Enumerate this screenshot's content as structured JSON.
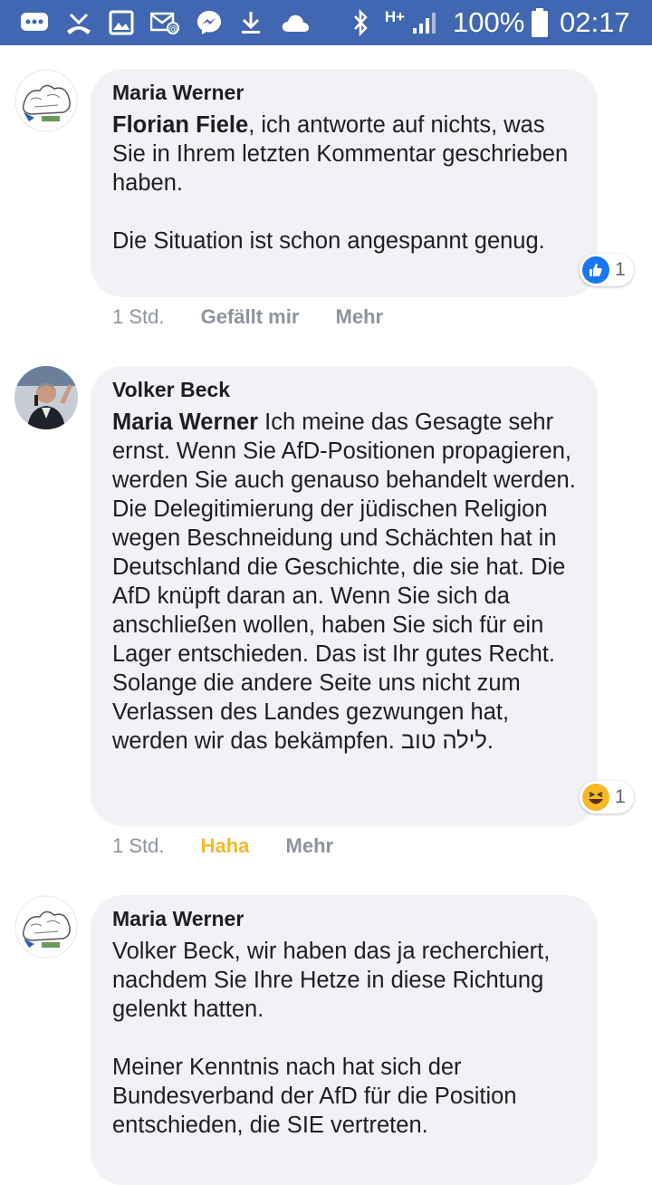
{
  "status_bar": {
    "battery": "100%",
    "time": "02:17",
    "network": "H+"
  },
  "comments": [
    {
      "author": "Maria Werner",
      "mention": "Florian Fiele",
      "text_1": ", ich antworte auf nichts, was Sie in Ihrem letzten Kommentar geschrieben haben.",
      "text_2": "Die Situation ist schon angespannt genug.",
      "time": "1 Std.",
      "like_label": "Gefällt mir",
      "more_label": "Mehr",
      "reaction_count": "1",
      "reaction_type": "like-icon"
    },
    {
      "author": "Volker Beck",
      "mention": "Maria Werner",
      "text_1": " Ich meine das Gesagte sehr ernst. Wenn Sie AfD-Positionen propagieren, werden Sie auch genauso behandelt werden. Die Delegitimierung der jüdischen Religion wegen Beschneidung und Schächten hat in Deutschland die Geschichte, die sie hat. Die AfD knüpft daran an. Wenn Sie sich da anschließen wollen, haben Sie sich für ein Lager entschieden. Das ist Ihr gutes Recht. Solange die andere Seite uns nicht zum Verlassen des Landes gezwungen hat, werden wir das bekämpfen. לילה טוב.",
      "time": "1 Std.",
      "like_label": "Haha",
      "more_label": "Mehr",
      "reaction_count": "1",
      "reaction_type": "haha-icon"
    },
    {
      "author": "Maria Werner",
      "text_1": "Volker Beck, wir haben das ja recherchiert, nachdem Sie Ihre Hetze in diese Richtung gelenkt hatten.",
      "text_2": "Meiner Kenntnis nach hat sich der Bundesverband der AfD für die Position entschieden, die SIE vertreten."
    }
  ],
  "colors": {
    "status_bar": "#4267b2",
    "bubble": "#f0f2f5",
    "meta_text": "#8d949e",
    "haha": "#f7b928",
    "like_blue": "#1877f2"
  }
}
